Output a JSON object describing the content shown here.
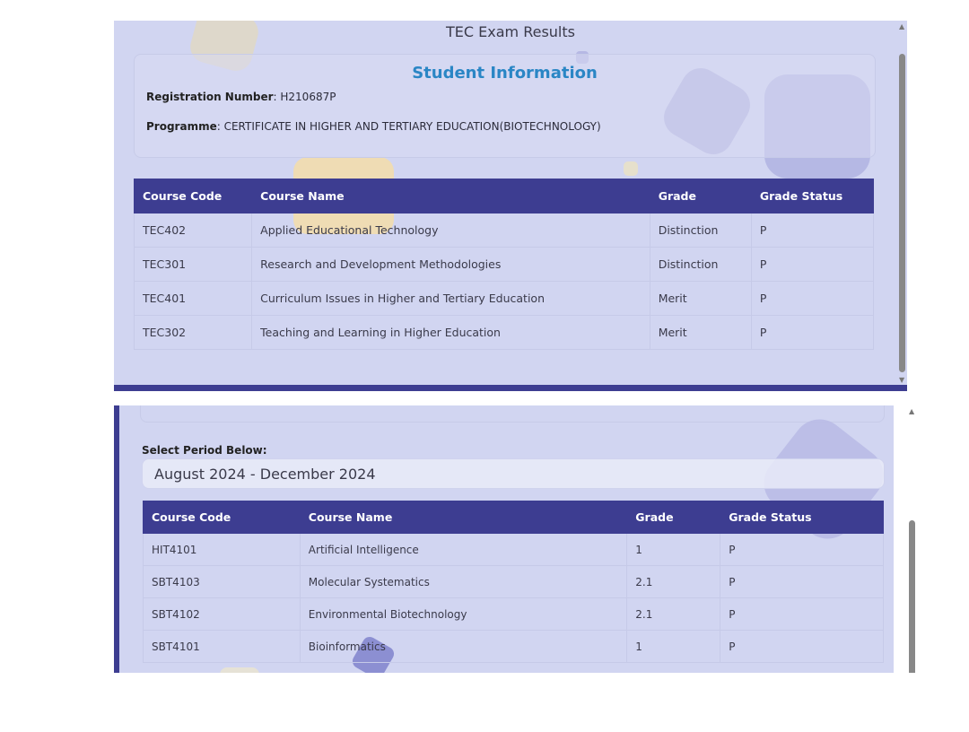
{
  "panel1": {
    "title": "TEC Exam Results",
    "info_heading": "Student Information",
    "registration_label": "Registration Number",
    "registration_value": ": H210687P",
    "programme_label": "Programme",
    "programme_value": ": CERTIFICATE IN HIGHER AND TERTIARY EDUCATION(BIOTECHNOLOGY)",
    "table": {
      "headers": [
        "Course Code",
        "Course Name",
        "Grade",
        "Grade Status"
      ],
      "rows": [
        [
          "TEC402",
          "Applied Educational Technology",
          "Distinction",
          "P"
        ],
        [
          "TEC301",
          "Research and Development Methodologies",
          "Distinction",
          "P"
        ],
        [
          "TEC401",
          "Curriculum Issues in Higher and Tertiary Education",
          "Merit",
          "P"
        ],
        [
          "TEC302",
          "Teaching and Learning in Higher Education",
          "Merit",
          "P"
        ]
      ]
    }
  },
  "panel2": {
    "period_label": "Select Period Below:",
    "period_value": "August 2024 - December 2024",
    "table": {
      "headers": [
        "Course Code",
        "Course Name",
        "Grade",
        "Grade Status"
      ],
      "rows": [
        [
          "HIT4101",
          "Artificial Intelligence",
          "1",
          "P"
        ],
        [
          "SBT4103",
          "Molecular Systematics",
          "2.1",
          "P"
        ],
        [
          "SBT4102",
          "Environmental Biotechnology",
          "2.1",
          "P"
        ],
        [
          "SBT4101",
          "Bioinformatics",
          "1",
          "P"
        ]
      ]
    }
  },
  "icons": {
    "scroll_up": "▲",
    "scroll_down": "▼"
  },
  "colors": {
    "panel_bg": "#d1d5f1",
    "header_bg": "#3d3d91",
    "heading_blue": "#2a86c5"
  }
}
